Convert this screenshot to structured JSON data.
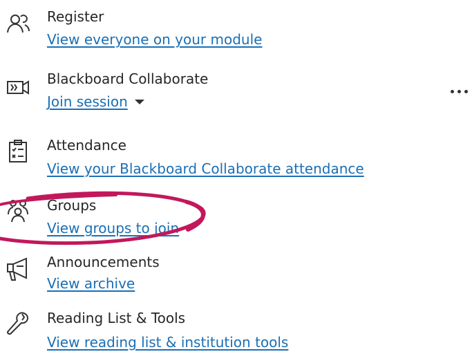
{
  "items": [
    {
      "title": "Register",
      "link": "View everyone on your module",
      "icon": "users-icon"
    },
    {
      "title": "Blackboard Collaborate",
      "link": "Join session",
      "icon": "collaborate-video-icon",
      "has_dropdown": true
    },
    {
      "title": "Attendance",
      "link": "View your Blackboard Collaborate attendance",
      "icon": "attendance-clipboard-icon"
    },
    {
      "title": "Groups",
      "link": "View groups to join",
      "icon": "groups-icon"
    },
    {
      "title": "Announcements",
      "link": "View archive",
      "icon": "megaphone-icon"
    },
    {
      "title": "Reading List & Tools",
      "link": "View reading list & institution tools",
      "icon": "wrench-icon"
    }
  ],
  "more_menu": {
    "icon": "more-options-icon"
  },
  "colors": {
    "text": "#262626",
    "link": "#1a6fb5",
    "annotation": "#c2185b"
  }
}
